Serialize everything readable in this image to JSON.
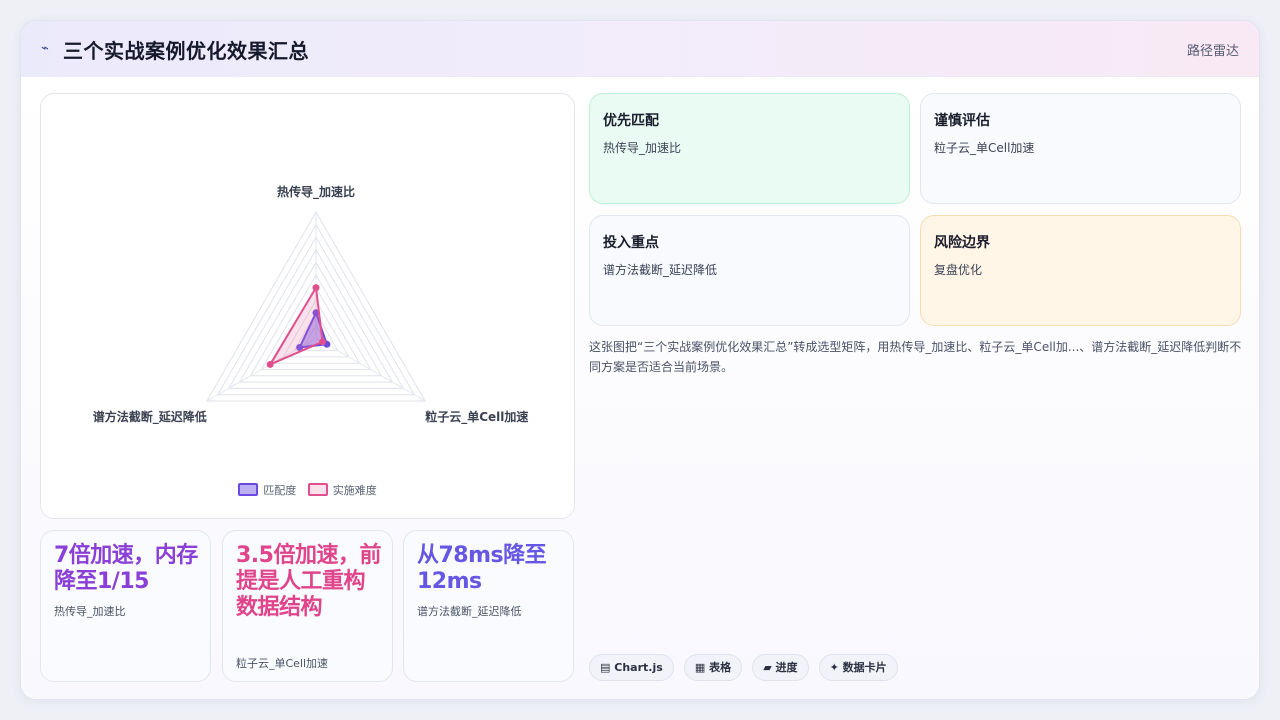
{
  "header": {
    "icon": "trend-line-icon",
    "title": "三个实战案例优化效果汇总",
    "tag": "路径雷达"
  },
  "chart_data": {
    "type": "radar",
    "axes": [
      "热传导_加速比",
      "粒子云_单Cell加速",
      "谱方法截断_延迟降低"
    ],
    "rmax": 10,
    "grid_levels": 10,
    "series": [
      {
        "name": "匹配度",
        "values": [
          2,
          1,
          1.5
        ],
        "color": "#6a4ae0",
        "fill": "rgba(110,80,230,0.45)"
      },
      {
        "name": "实施难度",
        "values": [
          4,
          0.6,
          4.2
        ],
        "color": "#e0508e",
        "fill": "rgba(236,120,170,0.22)"
      }
    ],
    "legend_position": "bottom"
  },
  "stats": [
    {
      "big": "7倍加速，内存降至1/15",
      "sub": "热传导_加速比",
      "color": "#8a3fd6"
    },
    {
      "big": "3.5倍加速，前提是人工重构数据结构",
      "sub": "粒子云_单Cell加速",
      "color": "#e0448b"
    },
    {
      "big": "从78ms降至12ms",
      "sub": "谱方法截断_延迟降低",
      "color": "#6557e3"
    }
  ],
  "boxes": [
    {
      "heading": "优先匹配",
      "text": "热传导_加速比",
      "bg": "#eafbf3",
      "border": "#bfeed6"
    },
    {
      "heading": "谨慎评估",
      "text": "粒子云_单Cell加速",
      "bg": "#f8fafd",
      "border": "#e2e6f0"
    },
    {
      "heading": "投入重点",
      "text": "谱方法截断_延迟降低",
      "bg": "#f8fafd",
      "border": "#e2e6f0"
    },
    {
      "heading": "风险边界",
      "text": "复盘优化",
      "bg": "#fff6e8",
      "border": "#f6ddb2"
    }
  ],
  "description": "这张图把“三个实战案例优化效果汇总”转成选型矩阵，用热传导_加速比、粒子云_单Cell加...、谱方法截断_延迟降低判断不同方案是否适合当前场景。",
  "chips": [
    {
      "icon": "chart-icon",
      "glyph": "▤",
      "label": "Chart.js"
    },
    {
      "icon": "table-icon",
      "glyph": "▦",
      "label": "表格"
    },
    {
      "icon": "progress-icon",
      "glyph": "▰",
      "label": "进度"
    },
    {
      "icon": "sparkle-icon",
      "glyph": "✦",
      "label": "数据卡片"
    }
  ]
}
